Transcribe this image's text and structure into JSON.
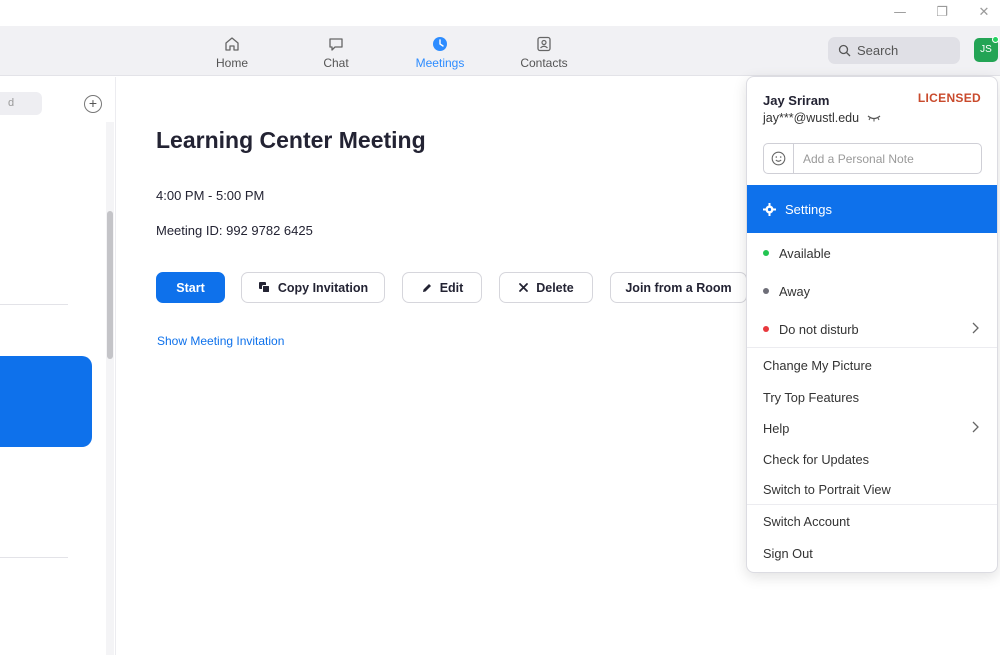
{
  "window": {
    "minimize_glyph": "—",
    "restore_glyph": "❐",
    "close_glyph": "✕"
  },
  "nav": {
    "tabs": [
      {
        "label": "Home",
        "icon": "home-icon"
      },
      {
        "label": "Chat",
        "icon": "chat-icon"
      },
      {
        "label": "Meetings",
        "icon": "clock-icon",
        "active": true
      },
      {
        "label": "Contacts",
        "icon": "contacts-icon"
      }
    ],
    "search_label": "Search",
    "avatar_initials": "JS",
    "accent_color": "#2d8cff"
  },
  "left": {
    "search_fragment": "d",
    "add_glyph": "+"
  },
  "meeting": {
    "title": "Learning Center Meeting",
    "time": "4:00 PM - 5:00 PM",
    "id_text": "Meeting ID: 992 9782 6425",
    "buttons": {
      "start": "Start",
      "copy": "Copy Invitation",
      "edit": "Edit",
      "delete": "Delete",
      "join_room": "Join from a Room"
    },
    "show_invitation": "Show Meeting Invitation"
  },
  "menu": {
    "user_name": "Jay Sriram",
    "license": "LICENSED",
    "email": "jay***@wustl.edu",
    "note_placeholder": "Add a Personal Note",
    "settings": "Settings",
    "status": [
      {
        "label": "Available",
        "color": "#23c552"
      },
      {
        "label": "Away",
        "color": "#6e6e78"
      },
      {
        "label": "Do not disturb",
        "color": "#e8383d"
      }
    ],
    "items": {
      "change_picture": "Change My Picture",
      "top_features": "Try Top Features",
      "help": "Help",
      "check_updates": "Check for Updates",
      "portrait_view": "Switch to Portrait View",
      "switch_account": "Switch Account",
      "sign_out": "Sign Out"
    },
    "primary_color": "#0e71eb"
  }
}
